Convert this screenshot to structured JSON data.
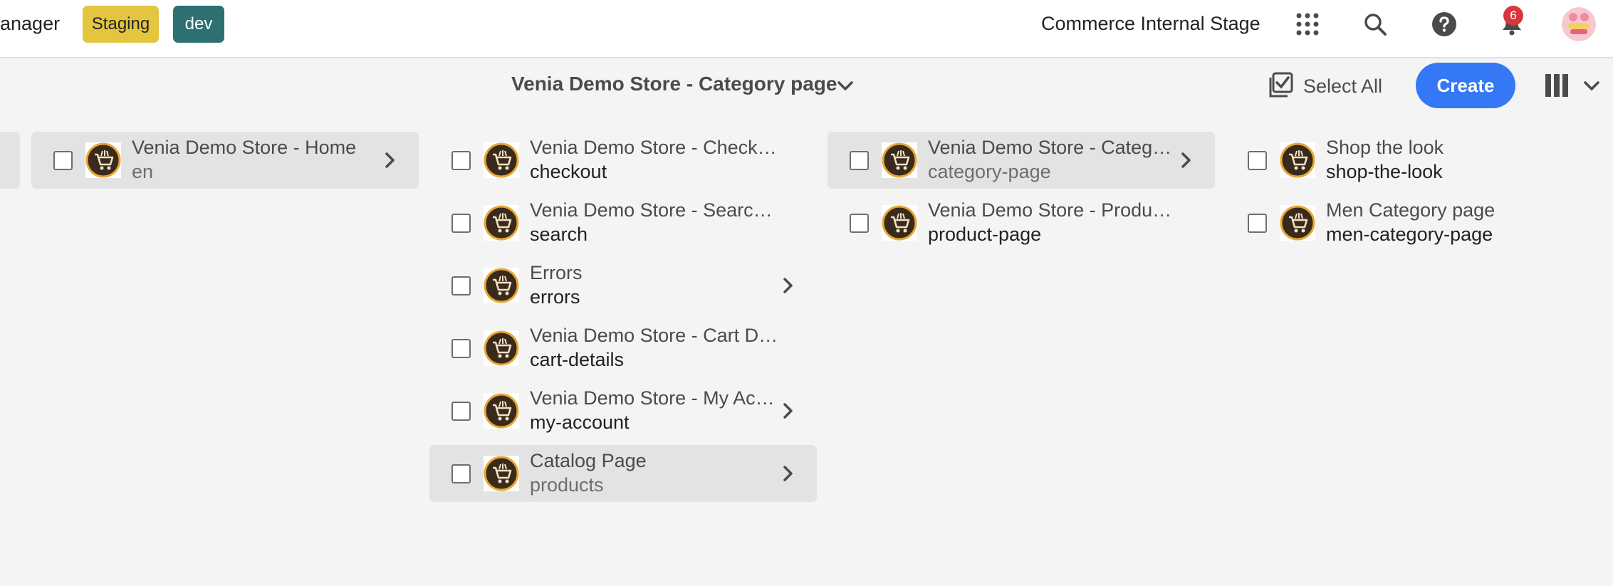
{
  "header": {
    "app_name": "anager",
    "env_staging": "Staging",
    "env_dev": "dev",
    "org_name": "Commerce Internal Stage",
    "notification_count": "6"
  },
  "actionbar": {
    "title": "Venia Demo Store - Category page",
    "select_all": "Select All",
    "create": "Create"
  },
  "columns": [
    {
      "items": [
        {
          "title": "Venia Demo Store - Home",
          "name": "en",
          "selected": true,
          "has_children": true
        }
      ]
    },
    {
      "items": [
        {
          "title": "Venia Demo Store - Checkout",
          "name": "checkout",
          "selected": false,
          "has_children": false
        },
        {
          "title": "Venia Demo Store - Search Re...",
          "name": "search",
          "selected": false,
          "has_children": false
        },
        {
          "title": "Errors",
          "name": "errors",
          "selected": false,
          "has_children": true
        },
        {
          "title": "Venia Demo Store - Cart Details",
          "name": "cart-details",
          "selected": false,
          "has_children": false
        },
        {
          "title": "Venia Demo Store - My Acco...",
          "name": "my-account",
          "selected": false,
          "has_children": true
        },
        {
          "title": "Catalog Page",
          "name": "products",
          "selected": true,
          "has_children": true
        }
      ]
    },
    {
      "items": [
        {
          "title": "Venia Demo Store - Category ...",
          "name": "category-page",
          "selected": true,
          "has_children": true
        },
        {
          "title": "Venia Demo Store - Product p...",
          "name": "product-page",
          "selected": false,
          "has_children": false
        }
      ]
    },
    {
      "items": [
        {
          "title": "Shop the look",
          "name": "shop-the-look",
          "selected": false,
          "has_children": false
        },
        {
          "title": "Men Category page",
          "name": "men-category-page",
          "selected": false,
          "has_children": false
        }
      ]
    }
  ]
}
